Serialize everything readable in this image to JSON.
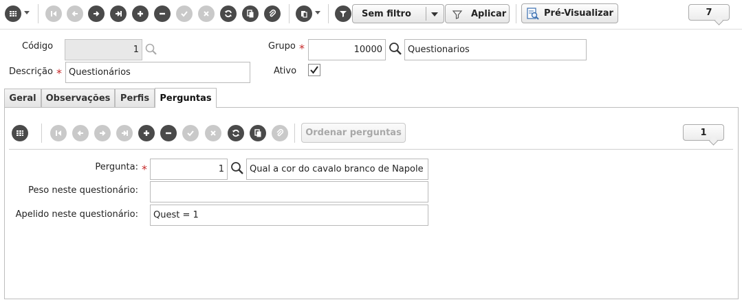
{
  "toolbar": {
    "filter_label": "Sem filtro",
    "apply_label": "Aplicar",
    "preview_label": "Pré-Visualizar",
    "record_count": "7"
  },
  "form": {
    "codigo_label": "Código",
    "codigo_value": "1",
    "grupo_label": "Grupo",
    "grupo_code": "10000",
    "grupo_name": "Questionarios",
    "descricao_label": "Descrição",
    "descricao_value": "Questionários",
    "ativo_label": "Ativo",
    "ativo_checked": true
  },
  "tabs": [
    {
      "label": "Geral"
    },
    {
      "label": "Observações"
    },
    {
      "label": "Perfis"
    },
    {
      "label": "Perguntas"
    }
  ],
  "subtoolbar": {
    "order_label": "Ordenar perguntas",
    "record_count": "1"
  },
  "detail": {
    "pergunta_label": "Pergunta:",
    "pergunta_code": "1",
    "pergunta_text": "Qual a cor do cavalo branco de Napole",
    "peso_label": "Peso neste questionário:",
    "peso_value": "",
    "apelido_label": "Apelido neste questionário:",
    "apelido_value": "Quest = 1"
  },
  "colors": {
    "required": "#c62828",
    "icon_active": "#4a4a4a",
    "icon_disabled": "#c9c9c9"
  }
}
